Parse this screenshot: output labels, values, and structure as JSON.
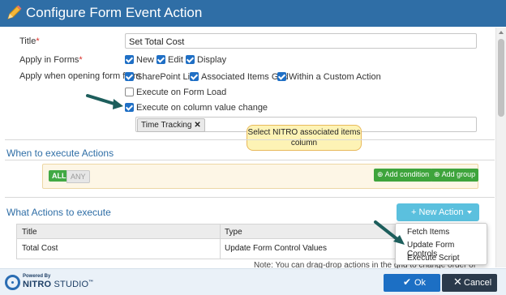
{
  "dialog": {
    "title": "Configure Form Event Action"
  },
  "form": {
    "title_label": "Title",
    "title_value": "Set Total Cost",
    "apply_forms_label": "Apply in Forms",
    "forms": [
      {
        "label": "New",
        "checked": true
      },
      {
        "label": "Edit",
        "checked": true
      },
      {
        "label": "Display",
        "checked": true
      }
    ],
    "apply_from_label": "Apply when opening form from",
    "sources": [
      {
        "label": "SharePoint List",
        "checked": true
      },
      {
        "label": "Associated Items Grid",
        "checked": true
      },
      {
        "label": "Within a Custom Action",
        "checked": true
      }
    ],
    "on_load_label": "Execute on Form Load",
    "on_load_checked": false,
    "on_change_label": "Execute on column value change",
    "on_change_checked": true,
    "column_tag": "Time Tracking",
    "tag_remove": "✕"
  },
  "callout": {
    "text": "Select NITRO associated items column"
  },
  "when": {
    "title": "When to execute Actions",
    "all": "ALL",
    "any": "ANY",
    "add_condition": "Add condition",
    "add_group": "Add group"
  },
  "what": {
    "title": "What Actions to execute",
    "new_action": "New Action",
    "plus": "+",
    "columns": [
      "Title",
      "Type"
    ],
    "rows": [
      {
        "title": "Total Cost",
        "type": "Update Form Control Values"
      }
    ],
    "note": "Note: You can drag-drop actions in the grid to change order of execution"
  },
  "dropdown": {
    "items": [
      "Fetch Items",
      "Update Form Controls",
      "Execute Script"
    ]
  },
  "footer": {
    "powered_by": "Powered By",
    "brand": "NITRO",
    "brand_suffix": "STUDIO",
    "trademark": "™",
    "ok": "Ok",
    "cancel": "Cancel"
  },
  "colors": {
    "header": "#2f6ea6",
    "accent_green": "#3ea43c",
    "info": "#5bc0de",
    "ok": "#1c6fc4",
    "cancel": "#2b3a4b",
    "callout": "#fdf3b5"
  }
}
